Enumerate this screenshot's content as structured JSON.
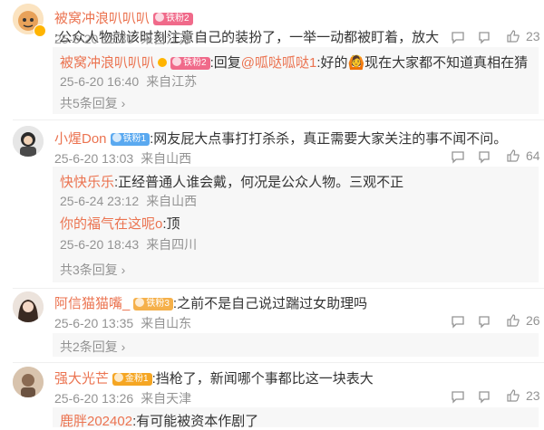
{
  "comments": [
    {
      "user": "被窝冲浪叭叭叭",
      "badge": "铁粉2",
      "text": ":公众人物就该时刻注意自己的装扮了，一举一动都被盯着，放大",
      "date": "25-6-20 13:30",
      "location": "来自江苏",
      "likes": "23",
      "replies": [
        {
          "user": "被窝冲浪叭叭叭",
          "badge": "铁粉2",
          "text_prefix": ":回复",
          "mention": "@呱哒呱哒1",
          "text": ":好的🙆现在大家都不知道真相在猜",
          "date": "25-6-20 16:40",
          "location": "来自江苏"
        }
      ],
      "more": "共5条回复"
    },
    {
      "user": "小煋Don",
      "badge": "铁粉1",
      "text": ":网友屁大点事打打杀杀，真正需要大家关注的事不闻不问。",
      "date": "25-6-20 13:03",
      "location": "来自山西",
      "likes": "64",
      "replies": [
        {
          "user": "快快乐乐",
          "text": ":正经普通人谁会戴，何况是公众人物。三观不正",
          "date": "25-6-24 23:12",
          "location": "来自山西"
        },
        {
          "user": "你的福气在这呢o",
          "text": ":顶",
          "date": "25-6-20 18:43",
          "location": "来自四川"
        }
      ],
      "more": "共3条回复"
    },
    {
      "user": "阿信猫猫嘴_",
      "badge": "铁粉3",
      "text": ":之前不是自己说过踹过女助理吗",
      "date": "25-6-20 13:35",
      "location": "来自山东",
      "likes": "26",
      "more": "共2条回复"
    },
    {
      "user": "强大光芒",
      "badge": "金粉1",
      "text": ":挡枪了，新闻哪个事都比这一块表大",
      "date": "25-6-20 13:26",
      "location": "来自天津",
      "likes": "23",
      "replies": [
        {
          "user": "鹿胖202402",
          "text": ":有可能被资本作剧了"
        }
      ]
    }
  ],
  "colors": {
    "name": "#eb7350",
    "meta": "#939393",
    "reply_bg": "#f7f7f7",
    "badge_pink": "#f06a8a",
    "badge_blue": "#5aa9f0",
    "badge_gold": "#f5a623"
  },
  "icons": [
    "reply-icon",
    "comment-icon",
    "thumb-up-icon",
    "verified-icon"
  ]
}
